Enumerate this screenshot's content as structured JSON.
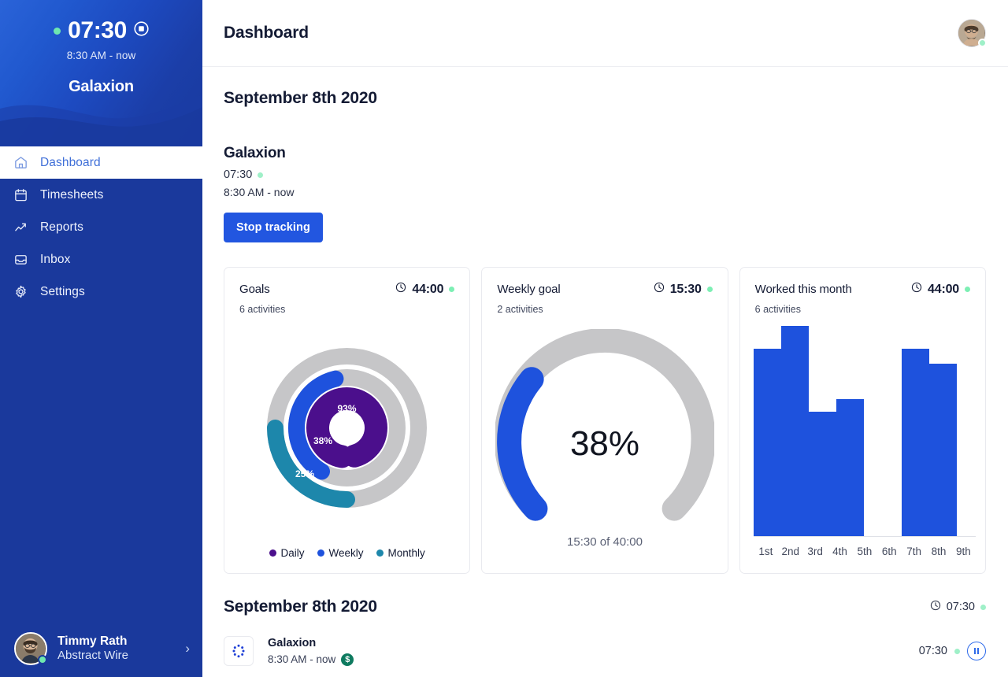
{
  "sidebar": {
    "timer": {
      "time": "07:30",
      "range": "8:30 AM - now",
      "project": "Galaxion",
      "stop_icon": "stop-record-icon",
      "status_dot": "active-dot"
    },
    "nav": [
      {
        "label": "Dashboard",
        "icon": "home-icon",
        "active": true
      },
      {
        "label": "Timesheets",
        "icon": "calendar-icon",
        "active": false
      },
      {
        "label": "Reports",
        "icon": "trending-up-icon",
        "active": false
      },
      {
        "label": "Inbox",
        "icon": "inbox-icon",
        "active": false
      },
      {
        "label": "Settings",
        "icon": "gear-icon",
        "active": false
      }
    ],
    "profile": {
      "name": "Timmy Rath",
      "org": "Abstract Wire",
      "chevron": "›"
    }
  },
  "topbar": {
    "title": "Dashboard",
    "avatar": "user-avatar"
  },
  "main": {
    "date_heading": "September 8th 2020",
    "tracker": {
      "project": "Galaxion",
      "time": "07:30",
      "range": "8:30 AM - now",
      "stop_label": "Stop tracking"
    },
    "cards": [
      {
        "title": "Goals",
        "metric": "44:00",
        "sub": "6 activities",
        "clock_icon": "clock-icon"
      },
      {
        "title": "Weekly goal",
        "metric": "15:30",
        "sub": "2 activities",
        "clock_icon": "clock-icon"
      },
      {
        "title": "Worked this month",
        "metric": "44:00",
        "sub": "6 activities",
        "clock_icon": "clock-icon"
      }
    ],
    "gauge_caption": "15:30 of 40:00"
  },
  "list": {
    "date": "September 8th 2020",
    "total": "07:30",
    "entries": [
      {
        "title": "Galaxion",
        "range": "8:30 AM - now",
        "billable": "$",
        "duration": "07:30",
        "icon": "dots-circle-icon",
        "action": "pause-icon"
      }
    ]
  },
  "colors": {
    "brand_blue": "#2256e0",
    "sidebar_blue": "#1a399c",
    "daily_purple": "#4b0f8c",
    "weekly_blue": "#1e52dd",
    "monthly_teal": "#1d87ab",
    "track_gray": "#c6c6c8",
    "status_green": "#7defb4",
    "billable_green": "#0e7a5f"
  },
  "chart_data": [
    {
      "type": "pie",
      "title": "Goals",
      "subtitle": "6 activities",
      "variant": "multi-ring-radial",
      "legend_position": "bottom",
      "series": [
        {
          "name": "Daily",
          "value": 93,
          "color": "#4b0f8c",
          "ring": "inner",
          "label": "93%"
        },
        {
          "name": "Weekly",
          "value": 38,
          "color": "#1e52dd",
          "ring": "middle",
          "label": "38%"
        },
        {
          "name": "Monthly",
          "value": 25,
          "color": "#1d87ab",
          "ring": "outer",
          "label": "25%"
        }
      ],
      "track_color": "#c6c6c8",
      "max": 100,
      "legend": [
        "Daily",
        "Weekly",
        "Monthly"
      ]
    },
    {
      "type": "pie",
      "title": "Weekly goal",
      "subtitle": "2 activities",
      "variant": "gauge",
      "value": 38,
      "value_label": "38%",
      "caption": "15:30 of 40:00",
      "max": 100,
      "color": "#1e52dd",
      "track_color": "#c6c6c8",
      "start_angle_deg": -135,
      "sweep_deg": 270
    },
    {
      "type": "bar",
      "title": "Worked this month",
      "subtitle": "6 activities",
      "categories": [
        "1st",
        "2nd",
        "3rd",
        "4th",
        "5th",
        "6th",
        "7th",
        "8th",
        "9th"
      ],
      "values": [
        8.9,
        10.0,
        5.9,
        6.5,
        0,
        0,
        8.9,
        8.2,
        0
      ],
      "ylim": [
        0,
        10
      ],
      "xlabel": "",
      "ylabel": "",
      "grid": false,
      "color": "#1e52dd",
      "legend": []
    }
  ]
}
